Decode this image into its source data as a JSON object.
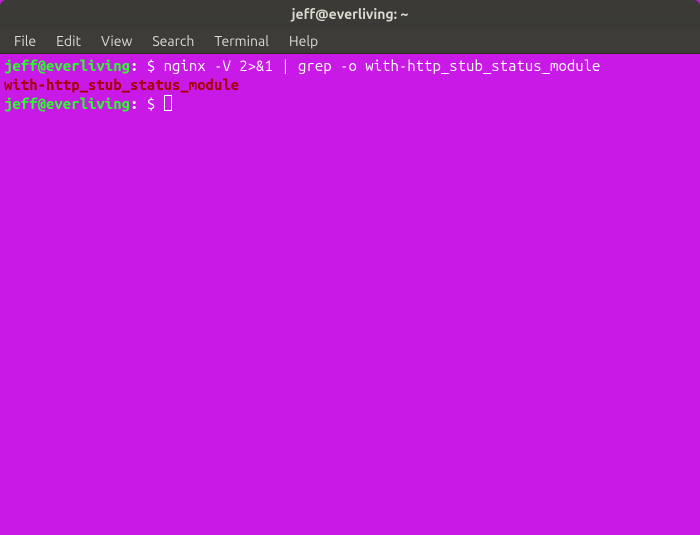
{
  "window": {
    "title": "jeff@everliving: ~"
  },
  "menubar": {
    "file": "File",
    "edit": "Edit",
    "view": "View",
    "search": "Search",
    "terminal": "Terminal",
    "help": "Help"
  },
  "prompt": {
    "user_host": "jeff@everliving",
    "colon": ":",
    "path_space": " ",
    "symbol": "$ "
  },
  "session": {
    "command1": "nginx -V 2>&1 | grep -o with-http_stub_status_module",
    "output1": "with-http_stub_status_module"
  }
}
